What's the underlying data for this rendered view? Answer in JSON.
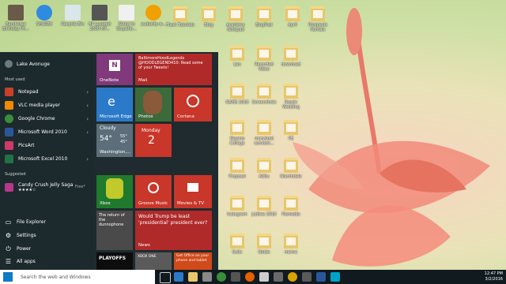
{
  "desktop": {
    "icons_row1": [
      "Bandeirae Birthday Ph...",
      "SHAREit",
      "Recycle Bin",
      "HP LaserJet 2600 HP...",
      "Sleep to Stupefio...",
      "audacity-w...",
      "Flash Tutorials",
      "Blog",
      "Academy Notepad",
      "BlogPost",
      "April",
      "Prospects Rentals"
    ],
    "col1": [
      "Leo",
      "Recorded Video",
      "download"
    ],
    "col2": [
      "GAME 2016",
      "Screenshots",
      "Rossie Wedding"
    ],
    "col3": [
      "Keyano College",
      "maryland convent...",
      "PE"
    ],
    "col4": [
      "Proposal",
      "Aditu",
      "Niamhdale"
    ],
    "col5": [
      "Instagram",
      "Jubilee 2016",
      "Piemedia"
    ],
    "col6": [
      "Suits",
      "Nolde",
      "meme"
    ]
  },
  "start_menu": {
    "user": "Lake Avonuge",
    "most_used_label": "Most used",
    "apps": [
      {
        "label": "Notepad",
        "color": "#c8402a"
      },
      {
        "label": "VLC media player",
        "color": "#f08a00"
      },
      {
        "label": "Google Chrome",
        "color": "#3a8d3a"
      },
      {
        "label": "Microsoft Word 2010",
        "color": "#2b579a"
      },
      {
        "label": "PicsArt",
        "color": "#d03a6a"
      },
      {
        "label": "Microsoft Excel 2010",
        "color": "#217346"
      }
    ],
    "suggested_label": "Suggested",
    "suggested_app": "Candy Crush Jelly Saga",
    "suggested_price": "Free*",
    "suggested_rating": "★★★★☆",
    "bottom": [
      "File Explorer",
      "Settings",
      "Power",
      "All apps"
    ]
  },
  "tiles": {
    "onenote": "OneNote",
    "mail_sender": "BaltimoreHoodLegends @HOODLEGEND410: Read some of your Tweets!",
    "mail": "Mail",
    "edge": "Microsoft Edge",
    "photos": "Photos",
    "cortana": "Cortana",
    "weather_cond": "Cloudy",
    "weather_temp": "54°",
    "weather_hi": "55°",
    "weather_lo": "45°",
    "weather_loc": "Washington,...",
    "calendar_day": "Monday",
    "calendar_date": "2",
    "xbox": "Xbox",
    "groove": "Groove Music",
    "movies": "Movies & TV",
    "news_story": "The return of the dunnophone",
    "news_headline": "Would Trump be least 'presidential' president ever?",
    "news": "News",
    "playoffs": "PLAYOFFS",
    "xbox_one": "XBOX ONE",
    "office": "Get Office on your phone and tablet"
  },
  "taskbar": {
    "search_placeholder": "Search the web and Windows",
    "time": "12:47 PM",
    "date": "3/2/2016"
  }
}
